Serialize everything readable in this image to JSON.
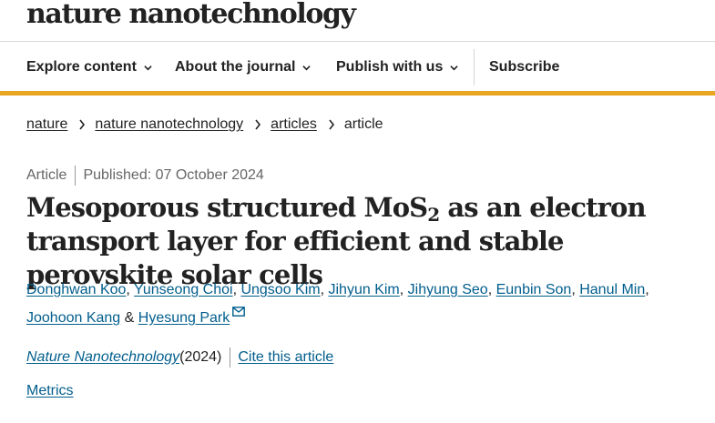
{
  "logo": "nature nanotechnology",
  "nav": {
    "explore": "Explore content",
    "about": "About the journal",
    "publish": "Publish with us",
    "subscribe": "Subscribe"
  },
  "colors": {
    "accent": "#e8a623",
    "link": "#025e8d",
    "text": "#222222"
  },
  "breadcrumb": {
    "items": [
      "nature",
      "nature nanotechnology",
      "articles"
    ],
    "current": "article"
  },
  "article": {
    "type": "Article",
    "published": "Published: 07 October 2024",
    "title_part1": "Mesoporous structured MoS",
    "title_sub": "2",
    "title_part2": " as an electron transport layer for efficient and stable perovskite solar cells",
    "authors": [
      "Donghwan Koo",
      "Yunseong Choi",
      "Ungsoo Kim",
      "Jihyun Kim",
      "Jihyung Seo",
      "Eunbin Son",
      "Hanul Min",
      "Joohoon Kang",
      "Hyesung Park"
    ],
    "and": " & ",
    "journal": "Nature Nanotechnology",
    "year": " (2024)",
    "cite": "Cite this article",
    "metrics": "Metrics"
  },
  "icons": [
    "chevron-down-icon",
    "chevron-right-icon",
    "mail-icon"
  ]
}
